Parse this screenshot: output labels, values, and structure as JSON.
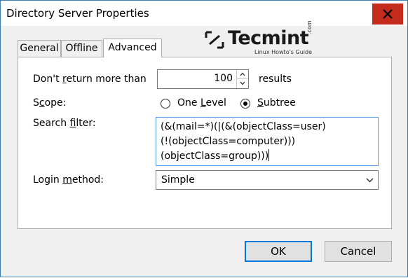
{
  "window": {
    "title": "Directory Server Properties",
    "close_glyph": "X"
  },
  "logo": {
    "brand": "Tecmint",
    "com": ".com",
    "tagline": "Linux Howto's Guide"
  },
  "tabs": [
    {
      "label": "General",
      "active": false
    },
    {
      "label": "Offline",
      "active": false
    },
    {
      "label": "Advanced",
      "active": true
    }
  ],
  "form": {
    "max_results": {
      "pre": "Don't ",
      "hot": "r",
      "post": "eturn more than",
      "value": "100",
      "suffix": "results"
    },
    "scope": {
      "pre": "S",
      "hot": "c",
      "post": "ope:",
      "options": [
        {
          "pre": "One ",
          "hot": "L",
          "post": "evel",
          "checked": false
        },
        {
          "pre": "",
          "hot": "S",
          "post": "ubtree",
          "checked": true
        }
      ]
    },
    "search_filter": {
      "pre": "Search ",
      "hot": "f",
      "post": "ilter:",
      "value": "(&(mail=*)(|(&(objectClass=user)\n(!(objectClass=computer)))\n(objectClass=group)))"
    },
    "login_method": {
      "pre": "Login ",
      "hot": "m",
      "post": "ethod:",
      "value": "Simple"
    }
  },
  "buttons": {
    "ok": "OK",
    "cancel": "Cancel"
  },
  "colors": {
    "close_red": "#c42b1c",
    "focus_blue": "#569de5",
    "default_button": "#0078d7"
  }
}
